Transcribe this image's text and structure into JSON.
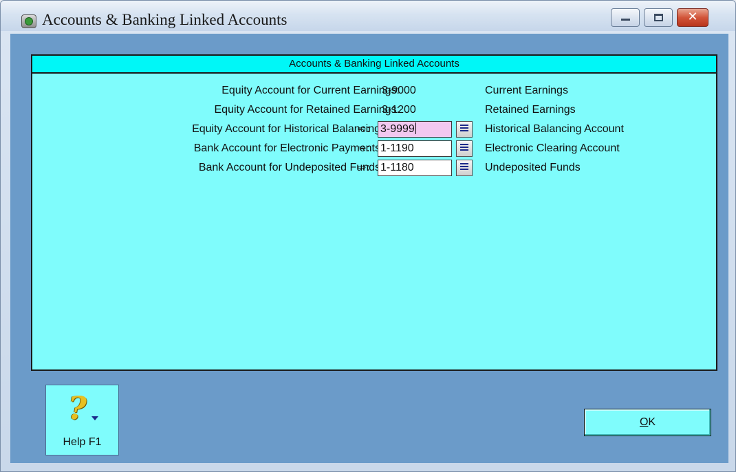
{
  "window": {
    "title": "Accounts & Banking Linked Accounts"
  },
  "panel": {
    "header": "Accounts & Banking Linked Accounts",
    "rows": [
      {
        "label": "Equity Account for Current Earnings:",
        "value": "3-9000",
        "account_name": "Current Earnings",
        "editable": false
      },
      {
        "label": "Equity Account for Retained Earnings:",
        "value": "3-1200",
        "account_name": "Retained Earnings",
        "editable": false
      },
      {
        "label": "Equity Account for Historical Balancing",
        "arrow": "⇨:",
        "value": "3-9999",
        "account_name": "Historical Balancing Account",
        "editable": true,
        "active": true
      },
      {
        "label": "Bank Account for Electronic Payments",
        "arrow": "⇨:",
        "value": "1-1190",
        "account_name": "Electronic Clearing Account",
        "editable": true
      },
      {
        "label": "Bank Account for Undeposited Funds",
        "arrow": "⇨:",
        "value": "1-1180",
        "account_name": "Undeposited Funds",
        "editable": true
      }
    ]
  },
  "buttons": {
    "help_label": "Help F1",
    "ok_underlined": "O",
    "ok_rest": "K"
  },
  "colors": {
    "panel_bg": "#7ffcfc",
    "header_bg": "#00f7f7",
    "client_bg": "#6b9bc9",
    "active_field_bg": "#f2c8f0"
  }
}
